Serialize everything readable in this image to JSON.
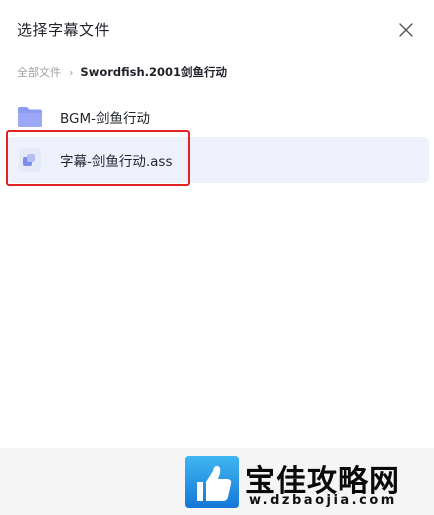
{
  "dialog": {
    "title": "选择字幕文件",
    "close_icon": "close-icon"
  },
  "breadcrumb": {
    "root": "全部文件",
    "separator": "›",
    "current": "Swordfish.2001剑鱼行动"
  },
  "items": [
    {
      "type": "folder",
      "icon": "folder-icon",
      "label": "BGM-剑鱼行动",
      "selected": false
    },
    {
      "type": "file",
      "icon": "subtitle-file-icon",
      "label": "字幕-剑鱼行动.ass",
      "selected": true
    }
  ],
  "annotation": {
    "color": "#e02323"
  },
  "watermark": {
    "brand": "宝佳攻略网",
    "url": "www.dzbaojia.com",
    "url_visible": "w.dzbaojia.com"
  },
  "colors": {
    "accent": "#7b8cf0",
    "selected_row_bg": "#eef0fc",
    "folder": "#8c9cf4"
  }
}
